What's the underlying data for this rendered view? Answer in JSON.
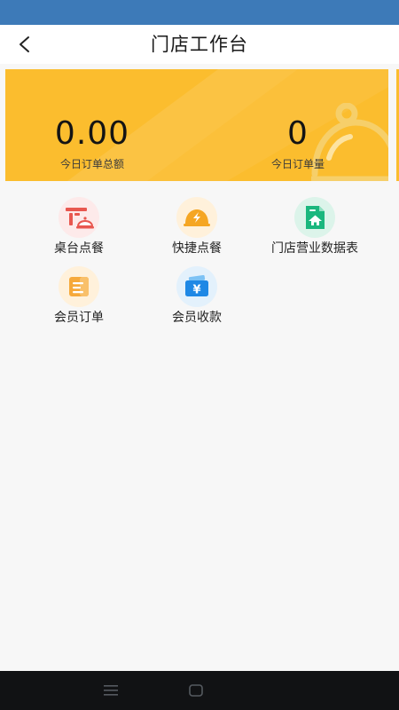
{
  "header": {
    "title": "门店工作台",
    "back_icon": "chevron-left-icon"
  },
  "summary": {
    "total_amount_value": "0.00",
    "total_amount_label": "今日订单总额",
    "order_count_value": "0",
    "order_count_label": "今日订单量",
    "decoration_icon": "cloche-icon"
  },
  "tiles": [
    {
      "label": "桌台点餐",
      "icon": "table-dining-icon",
      "color": "#e8574f"
    },
    {
      "label": "快捷点餐",
      "icon": "quick-order-cloche-icon",
      "color": "#f5a623"
    },
    {
      "label": "门店营业数据表",
      "icon": "store-report-icon",
      "color": "#1bb77e"
    },
    {
      "label": "会员订单",
      "icon": "member-order-icon",
      "color": "#f6a93b"
    },
    {
      "label": "会员收款",
      "icon": "wallet-yuan-icon",
      "color": "#1e88e5"
    }
  ],
  "colors": {
    "status_bar": "#3d7ab8",
    "card": "#fbbd2e",
    "background": "#f7f7f7",
    "nav_bar": "#111214"
  },
  "nav": {
    "menu_icon": "menu-lines-icon",
    "home_icon": "home-square-icon"
  }
}
